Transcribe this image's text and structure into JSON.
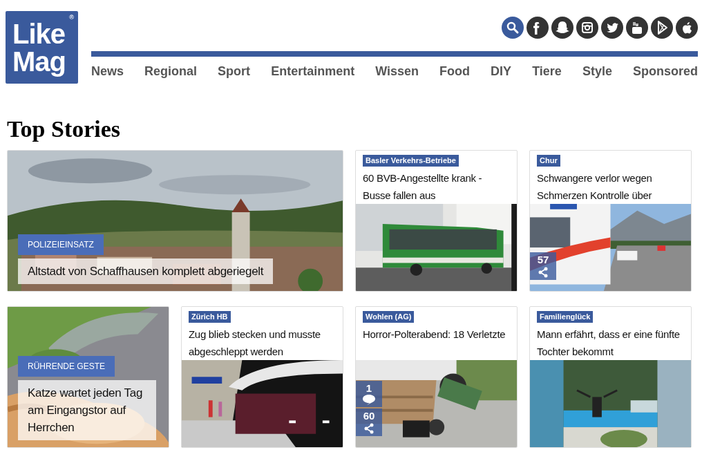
{
  "logo": {
    "line_1": "Like",
    "line_2": "Mag",
    "mark": "®"
  },
  "nav": [
    "News",
    "Regional",
    "Sport",
    "Entertainment",
    "Wissen",
    "Food",
    "DIY",
    "Tiere",
    "Style",
    "Sponsored"
  ],
  "heading": "Top Stories",
  "stories": [
    {
      "kind": "overlay",
      "wide": true,
      "label": "POLIZEIEINSATZ",
      "title": "Altstadt von Schaffhausen komplett abgeriegelt"
    },
    {
      "kind": "card",
      "label": "Basler Verkehrs-Betriebe",
      "title": "60 BVB-Angestellte krank - Busse fallen aus"
    },
    {
      "kind": "card",
      "label": "Chur",
      "title": "Schwangere verlor wegen Schmerzen Kontrolle über",
      "shares": "57"
    },
    {
      "kind": "overlay",
      "wide": false,
      "label": "RÜHRENDE GESTE",
      "title": "Katze wartet jeden Tag am Eingangstor auf Herrchen"
    },
    {
      "kind": "card",
      "label": "Zürich HB",
      "title": "Zug blieb stecken und musste abgeschleppt werden"
    },
    {
      "kind": "card",
      "label": "Wohlen (AG)",
      "title": "Horror-Polterabend: 18 Verletzte",
      "comments": "1",
      "shares": "60"
    },
    {
      "kind": "card",
      "label": "Familienglück",
      "title": "Mann erfährt, dass er eine fünfte Tochter bekommt"
    }
  ]
}
